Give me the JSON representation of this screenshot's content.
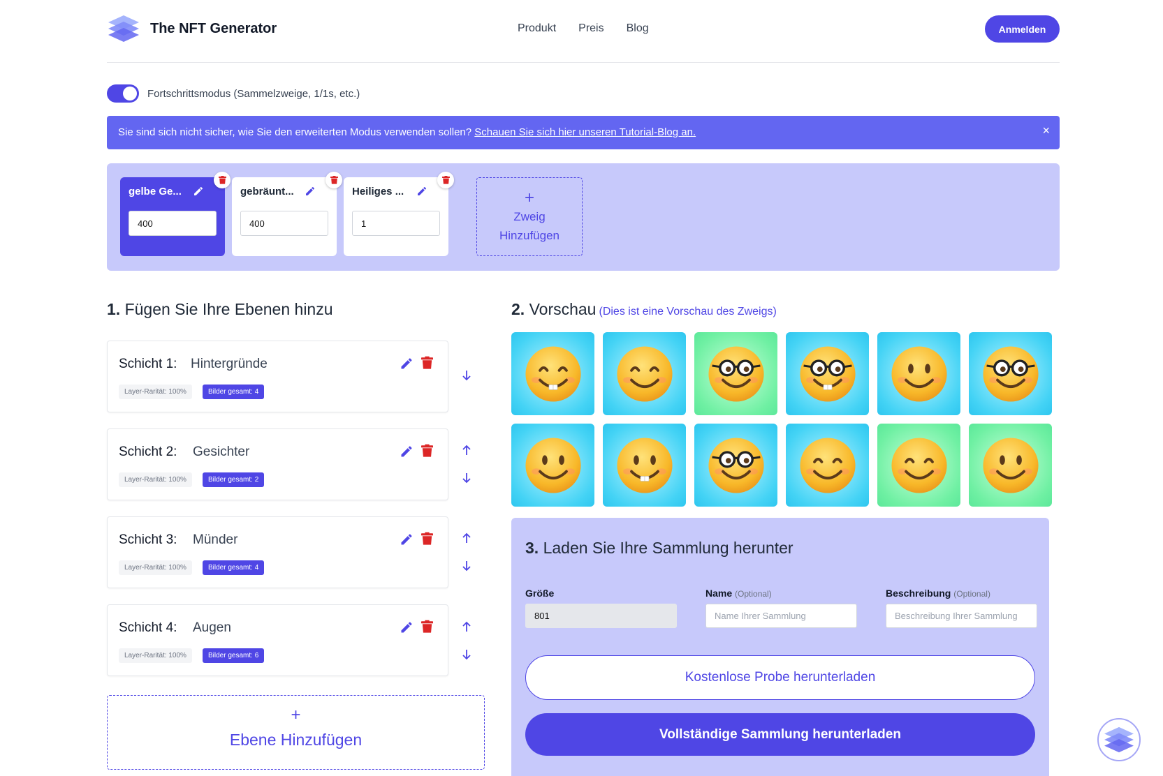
{
  "header": {
    "brand": "The NFT Generator",
    "nav": [
      "Produkt",
      "Preis",
      "Blog"
    ],
    "login_label": "Anmelden"
  },
  "mode_toggle": {
    "label": "Fortschrittsmodus (Sammelzweige, 1/1s, etc.)",
    "on": true
  },
  "banner": {
    "text": "Sie sind sich nicht sicher, wie Sie den erweiterten Modus verwenden sollen? ",
    "link": "Schauen Sie sich hier unseren Tutorial-Blog an.",
    "close": "×"
  },
  "branches": [
    {
      "title": "gelbe Ge...",
      "value": "400",
      "active": true
    },
    {
      "title": "gebräunt...",
      "value": "400",
      "active": false
    },
    {
      "title": "Heiliges ...",
      "value": "1",
      "active": false
    }
  ],
  "add_branch": {
    "plus": "+",
    "label_line1": "Zweig",
    "label_line2": "Hinzufügen"
  },
  "section1": {
    "num": "1.",
    "title": "Fügen Sie Ihre Ebenen hinzu",
    "layers": [
      {
        "num": "Schicht 1:",
        "name": "Hintergründe",
        "rarity": "Layer-Rarität: 100%",
        "total": "Bilder gesamt: 4"
      },
      {
        "num": "Schicht 2:",
        "name": "Gesichter",
        "rarity": "Layer-Rarität: 100%",
        "total": "Bilder gesamt: 2"
      },
      {
        "num": "Schicht 3:",
        "name": "Münder",
        "rarity": "Layer-Rarität: 100%",
        "total": "Bilder gesamt: 4"
      },
      {
        "num": "Schicht 4:",
        "name": "Augen",
        "rarity": "Layer-Rarität: 100%",
        "total": "Bilder gesamt: 6"
      }
    ],
    "add_layer": {
      "plus": "+",
      "label": "Ebene Hinzufügen"
    }
  },
  "section2": {
    "num": "2.",
    "title": "Vorschau",
    "subtitle": "(Dies ist eine Vorschau des Zweigs)",
    "tiles": [
      {
        "bg": "blue",
        "eyes": "happy",
        "mouth": "teeth"
      },
      {
        "bg": "blue",
        "eyes": "happy",
        "mouth": "smile"
      },
      {
        "bg": "green",
        "eyes": "glasses",
        "mouth": "smile"
      },
      {
        "bg": "blue",
        "eyes": "glasses",
        "mouth": "teeth"
      },
      {
        "bg": "blue",
        "eyes": "dots",
        "mouth": "smile"
      },
      {
        "bg": "blue",
        "eyes": "glasses",
        "mouth": "smile"
      },
      {
        "bg": "blue",
        "eyes": "dots",
        "mouth": "smile"
      },
      {
        "bg": "blue",
        "eyes": "dots",
        "mouth": "teeth"
      },
      {
        "bg": "blue",
        "eyes": "glasses",
        "mouth": "smile"
      },
      {
        "bg": "blue",
        "eyes": "happy",
        "mouth": "smile"
      },
      {
        "bg": "green",
        "eyes": "happy",
        "mouth": "smile"
      },
      {
        "bg": "green",
        "eyes": "dots",
        "mouth": "smile"
      }
    ]
  },
  "section3": {
    "num": "3.",
    "title": "Laden Sie Ihre Sammlung herunter",
    "size_label": "Größe",
    "size_value": "801",
    "name_label": "Name",
    "name_optional": "(Optional)",
    "name_placeholder": "Name Ihrer Sammlung",
    "desc_label": "Beschreibung",
    "desc_optional": "(Optional)",
    "desc_placeholder": "Beschreibung Ihrer Sammlung",
    "free_button": "Kostenlose Probe herunterladen",
    "full_button": "Vollständige Sammlung herunterladen"
  },
  "colors": {
    "accent": "#4f46e5",
    "panel": "#c7c9fb",
    "danger": "#dc2626"
  }
}
